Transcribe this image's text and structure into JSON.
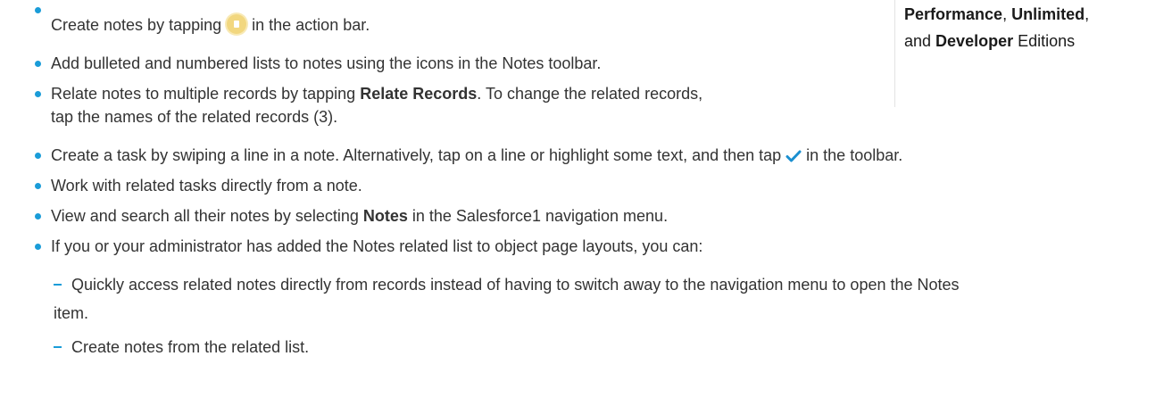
{
  "bullets": [
    {
      "before": "Create notes by tapping",
      "after": "in the action bar.",
      "icon": "note-icon"
    },
    {
      "text": "Add bulleted and numbered lists to notes using the icons in the Notes toolbar."
    },
    {
      "before": "Relate notes to multiple records by tapping ",
      "bold": "Relate Records",
      "after": ". To change the related records,",
      "line2": "tap the names of the related records (3)."
    },
    {
      "before": "Create a task by swiping a line in a note. Alternatively, tap on a line or highlight some text, and then tap",
      "after": "in the toolbar.",
      "icon": "checkmark-icon"
    },
    {
      "text": "Work with related tasks directly from a note."
    },
    {
      "before": "View and search all their notes by selecting ",
      "bold": "Notes",
      "after": " in the Salesforce1 navigation menu."
    },
    {
      "text": "If you or your administrator has added the Notes related list to object page layouts, you can:"
    }
  ],
  "subbullets": [
    {
      "line1": "Quickly access related notes directly from records instead of having to switch away to the navigation menu to open the Notes",
      "line2": "item."
    },
    {
      "text": "Create notes from the related list."
    }
  ],
  "sidebar": {
    "line1_bold1": "Performance",
    "line1_sep1": ", ",
    "line1_bold2": "Unlimited",
    "line1_sep2": ",",
    "line2_pre": "and ",
    "line2_bold": "Developer",
    "line2_post": " Editions"
  },
  "colors": {
    "bullet": "#1a9cd8",
    "text": "#333333",
    "note_icon": "#f2d77f",
    "check_icon": "#1a8fd0"
  }
}
